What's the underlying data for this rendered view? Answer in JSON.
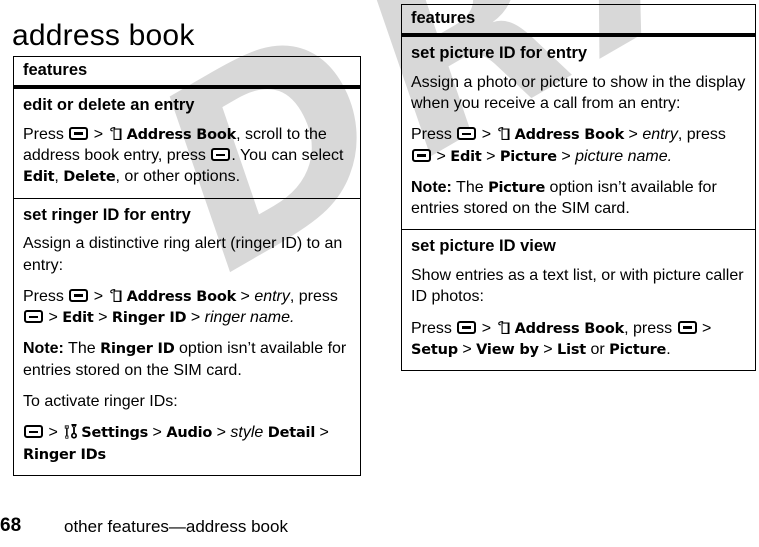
{
  "page": {
    "title": "address book",
    "number": "68",
    "footer_title": "other features—address book",
    "watermark": "DRAFT"
  },
  "icons": {
    "menu_key": "menu-key-icon",
    "address_book": "address-book-icon",
    "settings": "settings-tools-icon"
  },
  "tables": {
    "left": {
      "header": "features",
      "rows": [
        {
          "name": "edit or delete an entry",
          "paragraphs": [
            {
              "id": "edit-delete-steps",
              "text": "Press [MENU] > [BOOK] Address Book, scroll to the address book entry, press [MENU]. You can select Edit, Delete, or other options.",
              "segments": [
                {
                  "t": "Press ",
                  "s": "plain"
                },
                {
                  "t": "",
                  "s": "key-menu"
                },
                {
                  "t": " > ",
                  "s": "plain"
                },
                {
                  "t": "",
                  "s": "icon-address-book"
                },
                {
                  "t": "Address Book",
                  "s": "bold"
                },
                {
                  "t": ", scroll to the address book entry, press ",
                  "s": "plain"
                },
                {
                  "t": "",
                  "s": "key-menu"
                },
                {
                  "t": ". You can select ",
                  "s": "plain"
                },
                {
                  "t": "Edit",
                  "s": "bold"
                },
                {
                  "t": ", ",
                  "s": "plain"
                },
                {
                  "t": "Delete",
                  "s": "bold"
                },
                {
                  "t": ", or other options.",
                  "s": "plain"
                }
              ]
            }
          ]
        },
        {
          "name": "set ringer ID for entry",
          "paragraphs": [
            {
              "id": "ringer-intro",
              "segments": [
                {
                  "t": "Assign a distinctive ring alert (ringer ID) to an entry:",
                  "s": "plain"
                }
              ]
            },
            {
              "id": "ringer-steps",
              "segments": [
                {
                  "t": "Press ",
                  "s": "plain"
                },
                {
                  "t": "",
                  "s": "key-menu"
                },
                {
                  "t": " > ",
                  "s": "plain"
                },
                {
                  "t": "",
                  "s": "icon-address-book"
                },
                {
                  "t": "Address Book",
                  "s": "bold"
                },
                {
                  "t": " > ",
                  "s": "plain"
                },
                {
                  "t": "entry",
                  "s": "italic"
                },
                {
                  "t": ", press ",
                  "s": "plain"
                },
                {
                  "t": "",
                  "s": "key-menu"
                },
                {
                  "t": " > ",
                  "s": "plain"
                },
                {
                  "t": "Edit",
                  "s": "bold"
                },
                {
                  "t": " > ",
                  "s": "plain"
                },
                {
                  "t": "Ringer ID",
                  "s": "bold"
                },
                {
                  "t": " > ",
                  "s": "plain"
                },
                {
                  "t": "ringer name.",
                  "s": "italic"
                }
              ]
            },
            {
              "id": "ringer-note",
              "segments": [
                {
                  "t": "Note:",
                  "s": "note"
                },
                {
                  "t": " The ",
                  "s": "plain"
                },
                {
                  "t": "Ringer ID",
                  "s": "bold"
                },
                {
                  "t": " option isn’t available for entries stored on the SIM card.",
                  "s": "plain"
                }
              ]
            },
            {
              "id": "ringer-activate-intro",
              "segments": [
                {
                  "t": "To activate ringer IDs:",
                  "s": "plain"
                }
              ]
            },
            {
              "id": "ringer-activate-steps",
              "segments": [
                {
                  "t": "",
                  "s": "key-menu"
                },
                {
                  "t": " > ",
                  "s": "plain"
                },
                {
                  "t": "",
                  "s": "icon-settings"
                },
                {
                  "t": "Settings",
                  "s": "bold"
                },
                {
                  "t": " > ",
                  "s": "plain"
                },
                {
                  "t": "Audio",
                  "s": "bold"
                },
                {
                  "t": " > ",
                  "s": "plain"
                },
                {
                  "t": "style",
                  "s": "italic"
                },
                {
                  "t": " ",
                  "s": "plain"
                },
                {
                  "t": "Detail",
                  "s": "bold"
                },
                {
                  "t": " > ",
                  "s": "plain"
                },
                {
                  "t": "Ringer IDs",
                  "s": "bold"
                }
              ]
            }
          ]
        }
      ]
    },
    "right": {
      "header": "features",
      "rows": [
        {
          "name": "set picture ID for entry",
          "paragraphs": [
            {
              "id": "picture-intro",
              "segments": [
                {
                  "t": "Assign a photo or picture to show in the display when you receive a call from an entry:",
                  "s": "plain"
                }
              ]
            },
            {
              "id": "picture-steps",
              "segments": [
                {
                  "t": "Press ",
                  "s": "plain"
                },
                {
                  "t": "",
                  "s": "key-menu"
                },
                {
                  "t": " > ",
                  "s": "plain"
                },
                {
                  "t": "",
                  "s": "icon-address-book"
                },
                {
                  "t": "Address Book",
                  "s": "bold"
                },
                {
                  "t": " > ",
                  "s": "plain"
                },
                {
                  "t": "entry",
                  "s": "italic"
                },
                {
                  "t": ", press ",
                  "s": "plain"
                },
                {
                  "t": "",
                  "s": "key-menu"
                },
                {
                  "t": " > ",
                  "s": "plain"
                },
                {
                  "t": "Edit",
                  "s": "bold"
                },
                {
                  "t": " > ",
                  "s": "plain"
                },
                {
                  "t": "Picture",
                  "s": "bold"
                },
                {
                  "t": " > ",
                  "s": "plain"
                },
                {
                  "t": "picture name.",
                  "s": "italic"
                }
              ]
            },
            {
              "id": "picture-note",
              "segments": [
                {
                  "t": "Note:",
                  "s": "note"
                },
                {
                  "t": " The ",
                  "s": "plain"
                },
                {
                  "t": "Picture",
                  "s": "bold"
                },
                {
                  "t": " option isn’t available for entries stored on the SIM card.",
                  "s": "plain"
                }
              ]
            }
          ]
        },
        {
          "name": "set picture ID view",
          "paragraphs": [
            {
              "id": "picture-view-intro",
              "segments": [
                {
                  "t": "Show entries as a text list, or with picture caller ID photos:",
                  "s": "plain"
                }
              ]
            },
            {
              "id": "picture-view-steps",
              "segments": [
                {
                  "t": "Press ",
                  "s": "plain"
                },
                {
                  "t": "",
                  "s": "key-menu"
                },
                {
                  "t": " > ",
                  "s": "plain"
                },
                {
                  "t": "",
                  "s": "icon-address-book"
                },
                {
                  "t": "Address Book",
                  "s": "bold"
                },
                {
                  "t": ", press ",
                  "s": "plain"
                },
                {
                  "t": "",
                  "s": "key-menu"
                },
                {
                  "t": " > ",
                  "s": "plain"
                },
                {
                  "t": "Setup",
                  "s": "bold"
                },
                {
                  "t": " > ",
                  "s": "plain"
                },
                {
                  "t": "View by",
                  "s": "bold"
                },
                {
                  "t": " > ",
                  "s": "plain"
                },
                {
                  "t": "List",
                  "s": "bold"
                },
                {
                  "t": " or ",
                  "s": "plain"
                },
                {
                  "t": "Picture",
                  "s": "bold"
                },
                {
                  "t": ".",
                  "s": "plain"
                }
              ]
            }
          ]
        }
      ]
    }
  }
}
